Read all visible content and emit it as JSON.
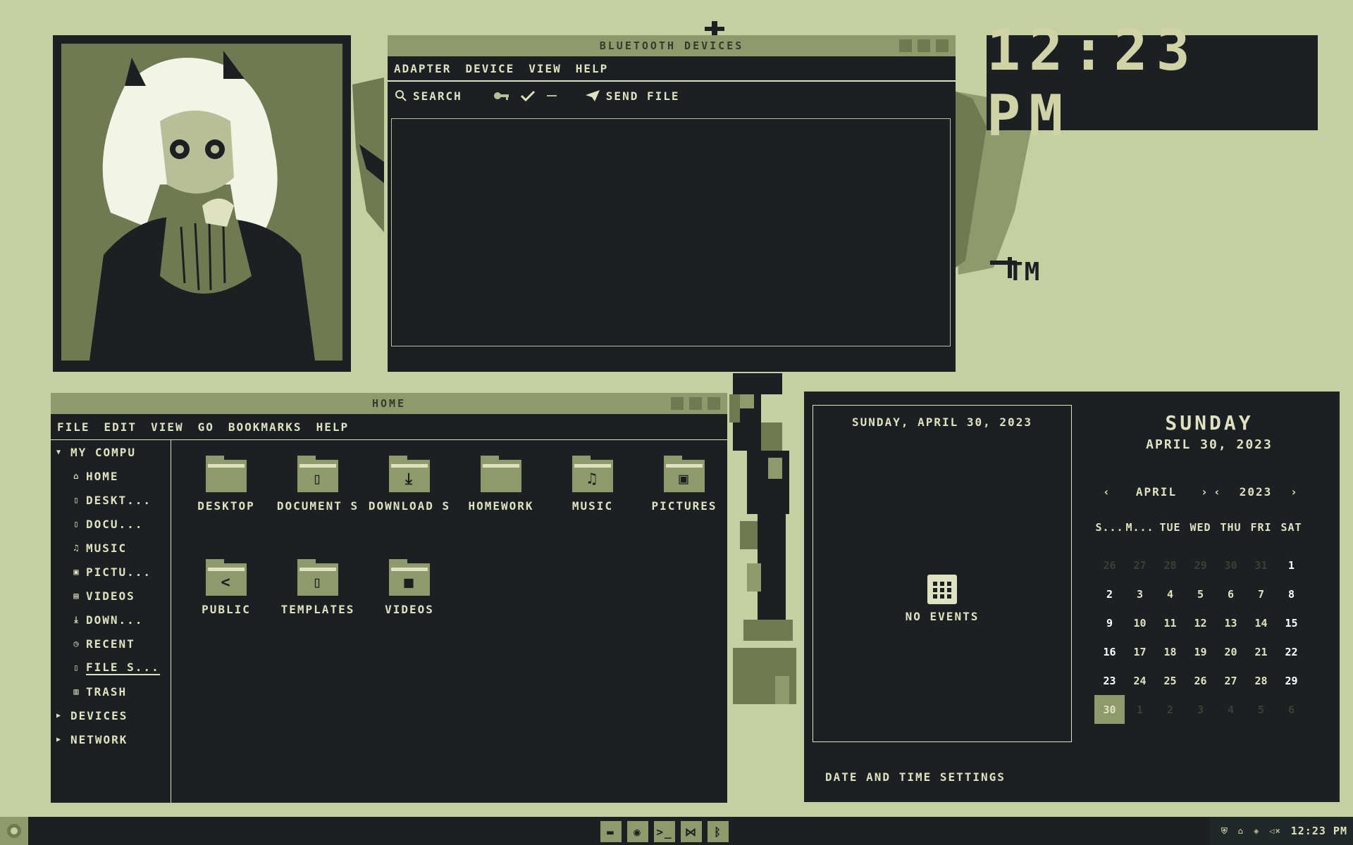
{
  "bluetooth": {
    "title": "BLUETOOTH DEVICES",
    "menu": [
      "ADAPTER",
      "DEVICE",
      "VIEW",
      "HELP"
    ],
    "toolbar": {
      "search": "SEARCH",
      "send_file": "SEND FILE"
    }
  },
  "clock": {
    "time": "12:23 PM"
  },
  "home": {
    "title": "HOME",
    "menu": [
      "FILE",
      "EDIT",
      "VIEW",
      "GO",
      "BOOKMARKS",
      "HELP"
    ],
    "sidebar": {
      "my_computer": "MY COMPU",
      "items": [
        {
          "icon": "home-icon",
          "glyph": "⌂",
          "label": "HOME"
        },
        {
          "icon": "desktop-icon",
          "glyph": "▯",
          "label": "DESKT..."
        },
        {
          "icon": "document-icon",
          "glyph": "▯",
          "label": "DOCU..."
        },
        {
          "icon": "music-icon",
          "glyph": "♫",
          "label": "MUSIC"
        },
        {
          "icon": "picture-icon",
          "glyph": "▣",
          "label": "PICTU..."
        },
        {
          "icon": "video-icon",
          "glyph": "▤",
          "label": "VIDEOS"
        },
        {
          "icon": "download-icon",
          "glyph": "⤓",
          "label": "DOWN..."
        },
        {
          "icon": "recent-icon",
          "glyph": "◷",
          "label": "RECENT"
        },
        {
          "icon": "filesystem-icon",
          "glyph": "▯",
          "label": "FILE S..."
        },
        {
          "icon": "trash-icon",
          "glyph": "▥",
          "label": "TRASH"
        }
      ],
      "devices": "DEVICES",
      "network": "NETWORK"
    },
    "folders": [
      {
        "name": "DESKTOP",
        "icon": "folder-desktop-icon",
        "glyph": ""
      },
      {
        "name": "DOCUMENT S",
        "icon": "folder-documents-icon",
        "glyph": "▯"
      },
      {
        "name": "DOWNLOAD S",
        "icon": "folder-downloads-icon",
        "glyph": "⤓"
      },
      {
        "name": "HOMEWORK",
        "icon": "folder-homework-icon",
        "glyph": ""
      },
      {
        "name": "MUSIC",
        "icon": "folder-music-icon",
        "glyph": "♫"
      },
      {
        "name": "PICTURES",
        "icon": "folder-pictures-icon",
        "glyph": "▣"
      },
      {
        "name": "PUBLIC",
        "icon": "folder-public-icon",
        "glyph": "<"
      },
      {
        "name": "TEMPLATES",
        "icon": "folder-templates-icon",
        "glyph": "▯"
      },
      {
        "name": "VIDEOS",
        "icon": "folder-videos-icon",
        "glyph": "■"
      }
    ]
  },
  "calendar": {
    "event_date": "SUNDAY, APRIL 30, 2023",
    "no_events": "NO EVENTS",
    "settings": "DATE AND TIME SETTINGS",
    "day_name": "SUNDAY",
    "full_date": "APRIL 30, 2023",
    "month": "APRIL",
    "year": "2023",
    "weekdays": [
      "S...",
      "M...",
      "TUE",
      "WED",
      "THU",
      "FRI",
      "SAT"
    ],
    "days": [
      {
        "d": "26",
        "t": "dim"
      },
      {
        "d": "27",
        "t": "dim"
      },
      {
        "d": "28",
        "t": "dim"
      },
      {
        "d": "29",
        "t": "dim"
      },
      {
        "d": "30",
        "t": "dim"
      },
      {
        "d": "31",
        "t": "dim"
      },
      {
        "d": "1",
        "t": "wk"
      },
      {
        "d": "2",
        "t": "wk"
      },
      {
        "d": "3",
        "t": ""
      },
      {
        "d": "4",
        "t": ""
      },
      {
        "d": "5",
        "t": ""
      },
      {
        "d": "6",
        "t": ""
      },
      {
        "d": "7",
        "t": ""
      },
      {
        "d": "8",
        "t": "wk"
      },
      {
        "d": "9",
        "t": "wk"
      },
      {
        "d": "10",
        "t": ""
      },
      {
        "d": "11",
        "t": ""
      },
      {
        "d": "12",
        "t": ""
      },
      {
        "d": "13",
        "t": ""
      },
      {
        "d": "14",
        "t": ""
      },
      {
        "d": "15",
        "t": "wk"
      },
      {
        "d": "16",
        "t": "wk"
      },
      {
        "d": "17",
        "t": ""
      },
      {
        "d": "18",
        "t": ""
      },
      {
        "d": "19",
        "t": ""
      },
      {
        "d": "20",
        "t": ""
      },
      {
        "d": "21",
        "t": ""
      },
      {
        "d": "22",
        "t": "wk"
      },
      {
        "d": "23",
        "t": "wk"
      },
      {
        "d": "24",
        "t": ""
      },
      {
        "d": "25",
        "t": ""
      },
      {
        "d": "26",
        "t": ""
      },
      {
        "d": "27",
        "t": ""
      },
      {
        "d": "28",
        "t": ""
      },
      {
        "d": "29",
        "t": "wk"
      },
      {
        "d": "30",
        "t": "today"
      },
      {
        "d": "1",
        "t": "dim"
      },
      {
        "d": "2",
        "t": "dim"
      },
      {
        "d": "3",
        "t": "dim"
      },
      {
        "d": "4",
        "t": "dim"
      },
      {
        "d": "5",
        "t": "dim"
      },
      {
        "d": "6",
        "t": "dim"
      }
    ]
  },
  "taskbar": {
    "time": "12:23 PM",
    "apps": [
      {
        "name": "file-manager-icon",
        "glyph": "▬"
      },
      {
        "name": "firefox-icon",
        "glyph": "◉"
      },
      {
        "name": "terminal-icon",
        "glyph": ">_"
      },
      {
        "name": "vscode-icon",
        "glyph": "⋈"
      },
      {
        "name": "bluetooth-icon",
        "glyph": "ᛒ"
      }
    ],
    "tray_icons": [
      "shield-icon",
      "usb-icon",
      "vpn-icon",
      "volume-muted-icon"
    ]
  },
  "colors": {
    "background": "#c6cfa1",
    "window": "#1c2023",
    "accent": "#8e9a6b",
    "text": "#dfe2c0"
  }
}
